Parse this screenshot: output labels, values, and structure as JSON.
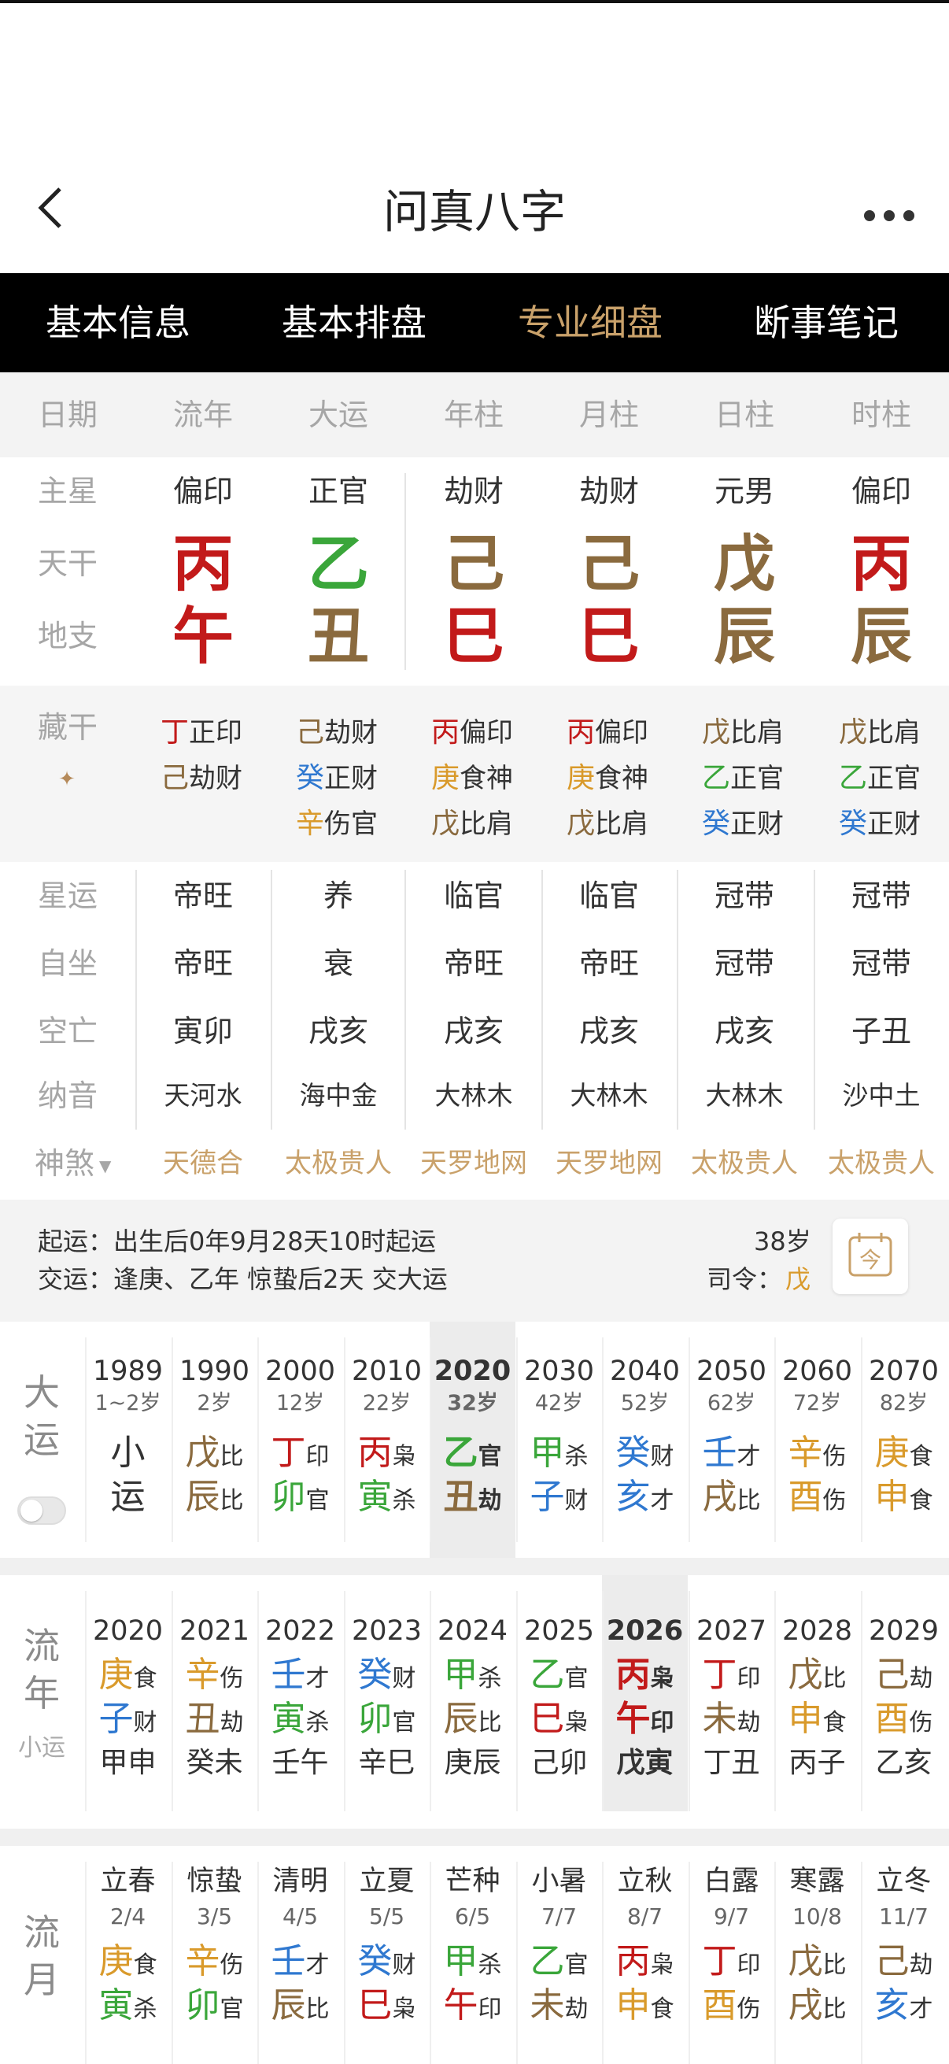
{
  "app": {
    "title": "问真八字",
    "back_icon": "chevron-left-icon",
    "more_icon": "more-horizontal-icon"
  },
  "tabs": [
    {
      "label": "基本信息"
    },
    {
      "label": "基本排盘"
    },
    {
      "label": "专业细盘",
      "active": true
    },
    {
      "label": "断事笔记"
    }
  ],
  "columns": [
    "日期",
    "流年",
    "大运",
    "年柱",
    "月柱",
    "日柱",
    "时柱"
  ],
  "row_labels": {
    "star": "主星",
    "stem": "天干",
    "branch": "地支",
    "hidden": "藏干",
    "xingyun": "星运",
    "zizuo": "自坐",
    "kongwang": "空亡",
    "nayin": "纳音",
    "shensha": "神煞"
  },
  "main_stars": [
    "偏印",
    "正官",
    "劫财",
    "劫财",
    "元男",
    "偏印"
  ],
  "stems": [
    {
      "c": "丙",
      "color": "#c21a1a"
    },
    {
      "c": "乙",
      "color": "#3aa63a"
    },
    {
      "c": "己",
      "color": "#8a6a3e"
    },
    {
      "c": "己",
      "color": "#8a6a3e"
    },
    {
      "c": "戊",
      "color": "#8a6a3e"
    },
    {
      "c": "丙",
      "color": "#c21a1a"
    }
  ],
  "branches": [
    {
      "c": "午",
      "color": "#c21a1a"
    },
    {
      "c": "丑",
      "color": "#8a6a3e"
    },
    {
      "c": "巳",
      "color": "#c21a1a"
    },
    {
      "c": "巳",
      "color": "#c21a1a"
    },
    {
      "c": "辰",
      "color": "#8a6a3e"
    },
    {
      "c": "辰",
      "color": "#8a6a3e"
    }
  ],
  "hidden_stems": [
    [
      {
        "g": "丁",
        "color": "#c21a1a",
        "s": "正印"
      },
      {
        "g": "己",
        "color": "#8a6a3e",
        "s": "劫财"
      }
    ],
    [
      {
        "g": "己",
        "color": "#8a6a3e",
        "s": "劫财"
      },
      {
        "g": "癸",
        "color": "#2f78d0",
        "s": "正财"
      },
      {
        "g": "辛",
        "color": "#d99a2b",
        "s": "伤官"
      }
    ],
    [
      {
        "g": "丙",
        "color": "#c21a1a",
        "s": "偏印"
      },
      {
        "g": "庚",
        "color": "#d99a2b",
        "s": "食神"
      },
      {
        "g": "戊",
        "color": "#8a6a3e",
        "s": "比肩"
      }
    ],
    [
      {
        "g": "丙",
        "color": "#c21a1a",
        "s": "偏印"
      },
      {
        "g": "庚",
        "color": "#d99a2b",
        "s": "食神"
      },
      {
        "g": "戊",
        "color": "#8a6a3e",
        "s": "比肩"
      }
    ],
    [
      {
        "g": "戊",
        "color": "#8a6a3e",
        "s": "比肩"
      },
      {
        "g": "乙",
        "color": "#3aa63a",
        "s": "正官"
      },
      {
        "g": "癸",
        "color": "#2f78d0",
        "s": "正财"
      }
    ],
    [
      {
        "g": "戊",
        "color": "#8a6a3e",
        "s": "比肩"
      },
      {
        "g": "乙",
        "color": "#3aa63a",
        "s": "正官"
      },
      {
        "g": "癸",
        "color": "#2f78d0",
        "s": "正财"
      }
    ]
  ],
  "xingyun": [
    "帝旺",
    "养",
    "临官",
    "临官",
    "冠带",
    "冠带"
  ],
  "zizuo": [
    "帝旺",
    "衰",
    "帝旺",
    "帝旺",
    "冠带",
    "冠带"
  ],
  "kongwang": [
    "寅卯",
    "戌亥",
    "戌亥",
    "戌亥",
    "戌亥",
    "子丑"
  ],
  "nayin": [
    "天河水",
    "海中金",
    "大林木",
    "大林木",
    "大林木",
    "沙中土"
  ],
  "shensha": [
    "天德合",
    "太极贵人",
    "天罗地网",
    "天罗地网",
    "太极贵人",
    "太极贵人"
  ],
  "qiyun": {
    "line1": "起运：出生后0年9月28天10时起运",
    "line2": "交运：逢庚、乙年 惊蛰后2天 交大运",
    "age": "38岁",
    "siling_label": "司令：",
    "siling_value": "戊",
    "cal_icon": "calendar-today-icon",
    "cal_char": "今"
  },
  "dayun": {
    "label_top": "大",
    "label_bottom": "运",
    "toggle_icon": "toggle-switch-icon",
    "items": [
      {
        "year": "1989",
        "age": "1~2岁",
        "plain": [
          "小",
          "运"
        ]
      },
      {
        "year": "1990",
        "age": "2岁",
        "g": [
          "戊",
          "辰"
        ],
        "gc": [
          "#8a6a3e",
          "#8a6a3e"
        ],
        "s": [
          "比",
          "比"
        ]
      },
      {
        "year": "2000",
        "age": "12岁",
        "g": [
          "丁",
          "卯"
        ],
        "gc": [
          "#c21a1a",
          "#3aa63a"
        ],
        "s": [
          "印",
          "官"
        ]
      },
      {
        "year": "2010",
        "age": "22岁",
        "g": [
          "丙",
          "寅"
        ],
        "gc": [
          "#c21a1a",
          "#3aa63a"
        ],
        "s": [
          "枭",
          "杀"
        ]
      },
      {
        "year": "2020",
        "age": "32岁",
        "g": [
          "乙",
          "丑"
        ],
        "gc": [
          "#3aa63a",
          "#8a6a3e"
        ],
        "s": [
          "官",
          "劫"
        ],
        "current": true
      },
      {
        "year": "2030",
        "age": "42岁",
        "g": [
          "甲",
          "子"
        ],
        "gc": [
          "#3aa63a",
          "#2f78d0"
        ],
        "s": [
          "杀",
          "财"
        ]
      },
      {
        "year": "2040",
        "age": "52岁",
        "g": [
          "癸",
          "亥"
        ],
        "gc": [
          "#2f78d0",
          "#2f78d0"
        ],
        "s": [
          "财",
          "才"
        ]
      },
      {
        "year": "2050",
        "age": "62岁",
        "g": [
          "壬",
          "戌"
        ],
        "gc": [
          "#2f78d0",
          "#8a6a3e"
        ],
        "s": [
          "才",
          "比"
        ]
      },
      {
        "year": "2060",
        "age": "72岁",
        "g": [
          "辛",
          "酉"
        ],
        "gc": [
          "#d99a2b",
          "#d99a2b"
        ],
        "s": [
          "伤",
          "伤"
        ]
      },
      {
        "year": "2070",
        "age": "82岁",
        "g": [
          "庚",
          "申"
        ],
        "gc": [
          "#d99a2b",
          "#d99a2b"
        ],
        "s": [
          "食",
          "食"
        ]
      }
    ]
  },
  "liunian": {
    "label_top": "流",
    "label_bottom": "年",
    "sub_label": "小运",
    "items": [
      {
        "year": "2020",
        "g": [
          "庚",
          "子"
        ],
        "gc": [
          "#d99a2b",
          "#2f78d0"
        ],
        "s": [
          "食",
          "财"
        ],
        "xy": "甲申"
      },
      {
        "year": "2021",
        "g": [
          "辛",
          "丑"
        ],
        "gc": [
          "#d99a2b",
          "#8a6a3e"
        ],
        "s": [
          "伤",
          "劫"
        ],
        "xy": "癸未"
      },
      {
        "year": "2022",
        "g": [
          "壬",
          "寅"
        ],
        "gc": [
          "#2f78d0",
          "#3aa63a"
        ],
        "s": [
          "才",
          "杀"
        ],
        "xy": "壬午"
      },
      {
        "year": "2023",
        "g": [
          "癸",
          "卯"
        ],
        "gc": [
          "#2f78d0",
          "#3aa63a"
        ],
        "s": [
          "财",
          "官"
        ],
        "xy": "辛巳"
      },
      {
        "year": "2024",
        "g": [
          "甲",
          "辰"
        ],
        "gc": [
          "#3aa63a",
          "#8a6a3e"
        ],
        "s": [
          "杀",
          "比"
        ],
        "xy": "庚辰"
      },
      {
        "year": "2025",
        "g": [
          "乙",
          "巳"
        ],
        "gc": [
          "#3aa63a",
          "#c21a1a"
        ],
        "s": [
          "官",
          "枭"
        ],
        "xy": "己卯"
      },
      {
        "year": "2026",
        "g": [
          "丙",
          "午"
        ],
        "gc": [
          "#c21a1a",
          "#c21a1a"
        ],
        "s": [
          "枭",
          "印"
        ],
        "xy": "戊寅",
        "current": true
      },
      {
        "year": "2027",
        "g": [
          "丁",
          "未"
        ],
        "gc": [
          "#c21a1a",
          "#8a6a3e"
        ],
        "s": [
          "印",
          "劫"
        ],
        "xy": "丁丑"
      },
      {
        "year": "2028",
        "g": [
          "戊",
          "申"
        ],
        "gc": [
          "#8a6a3e",
          "#d99a2b"
        ],
        "s": [
          "比",
          "食"
        ],
        "xy": "丙子"
      },
      {
        "year": "2029",
        "g": [
          "己",
          "酉"
        ],
        "gc": [
          "#8a6a3e",
          "#d99a2b"
        ],
        "s": [
          "劫",
          "伤"
        ],
        "xy": "乙亥"
      }
    ]
  },
  "liuyue": {
    "label_top": "流",
    "label_bottom": "月",
    "items": [
      {
        "term": "立春",
        "date": "2/4",
        "g": [
          "庚",
          "寅"
        ],
        "gc": [
          "#d99a2b",
          "#3aa63a"
        ],
        "s": [
          "食",
          "杀"
        ]
      },
      {
        "term": "惊蛰",
        "date": "3/5",
        "g": [
          "辛",
          "卯"
        ],
        "gc": [
          "#d99a2b",
          "#3aa63a"
        ],
        "s": [
          "伤",
          "官"
        ]
      },
      {
        "term": "清明",
        "date": "4/5",
        "g": [
          "壬",
          "辰"
        ],
        "gc": [
          "#2f78d0",
          "#8a6a3e"
        ],
        "s": [
          "才",
          "比"
        ]
      },
      {
        "term": "立夏",
        "date": "5/5",
        "g": [
          "癸",
          "巳"
        ],
        "gc": [
          "#2f78d0",
          "#c21a1a"
        ],
        "s": [
          "财",
          "枭"
        ]
      },
      {
        "term": "芒种",
        "date": "6/5",
        "g": [
          "甲",
          "午"
        ],
        "gc": [
          "#3aa63a",
          "#c21a1a"
        ],
        "s": [
          "杀",
          "印"
        ]
      },
      {
        "term": "小暑",
        "date": "7/7",
        "g": [
          "乙",
          "未"
        ],
        "gc": [
          "#3aa63a",
          "#8a6a3e"
        ],
        "s": [
          "官",
          "劫"
        ]
      },
      {
        "term": "立秋",
        "date": "8/7",
        "g": [
          "丙",
          "申"
        ],
        "gc": [
          "#c21a1a",
          "#d99a2b"
        ],
        "s": [
          "枭",
          "食"
        ]
      },
      {
        "term": "白露",
        "date": "9/7",
        "g": [
          "丁",
          "酉"
        ],
        "gc": [
          "#c21a1a",
          "#d99a2b"
        ],
        "s": [
          "印",
          "伤"
        ]
      },
      {
        "term": "寒露",
        "date": "10/8",
        "g": [
          "戊",
          "戌"
        ],
        "gc": [
          "#8a6a3e",
          "#8a6a3e"
        ],
        "s": [
          "比",
          "比"
        ]
      },
      {
        "term": "立冬",
        "date": "11/7",
        "g": [
          "己",
          "亥"
        ],
        "gc": [
          "#8a6a3e",
          "#2f78d0"
        ],
        "s": [
          "劫",
          "才"
        ]
      }
    ]
  }
}
